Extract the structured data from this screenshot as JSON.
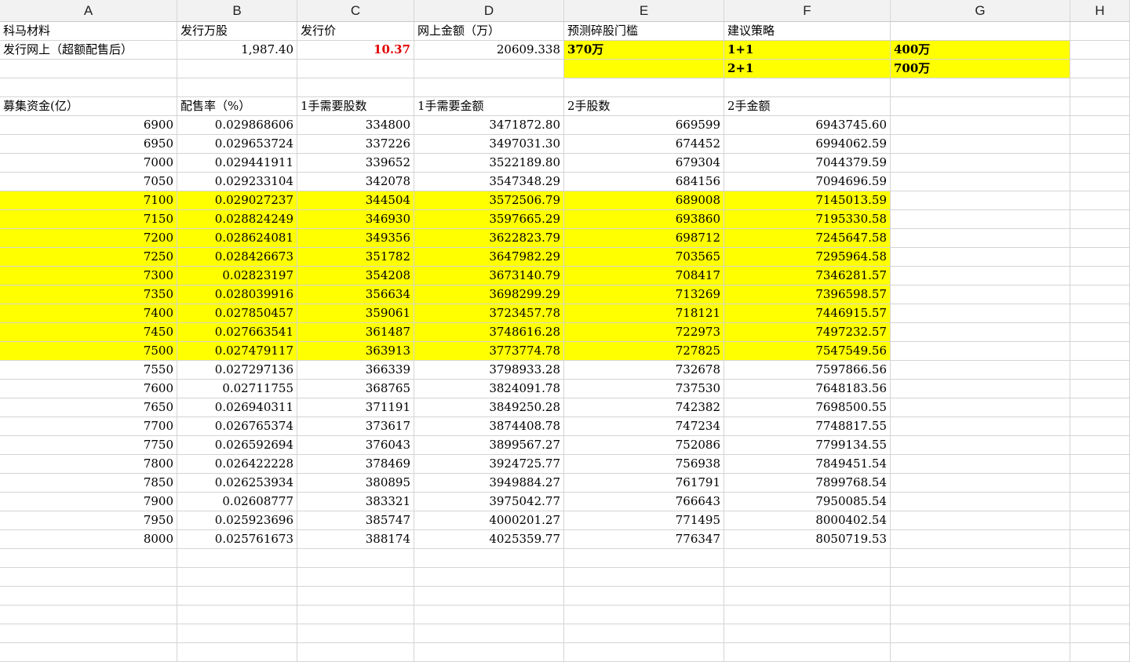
{
  "columns": [
    "A",
    "B",
    "C",
    "D",
    "E",
    "F",
    "G",
    "H"
  ],
  "info": {
    "title_label": "科马材料",
    "shares_label": "发行万股",
    "price_label": "发行价",
    "online_amount_label": "网上金额（万）",
    "threshold_label": "预测碎股门槛",
    "strategy_label": "建议策略",
    "issue_label": "发行网上（超额配售后）",
    "shares_value": "1,987.40",
    "price_value": "10.37",
    "online_amount_value": "20609.338",
    "threshold_value": "370万",
    "strategies": [
      {
        "name": "1+1",
        "amount": "400万"
      },
      {
        "name": "2+1",
        "amount": "700万"
      }
    ]
  },
  "table": {
    "headers": [
      "募集资金(亿）",
      "配售率（%）",
      "1手需要股数",
      "1手需要金额",
      "2手股数",
      "2手金额"
    ],
    "rows": [
      [
        "6900",
        "0.029868606",
        "334800",
        "3471872.80",
        "669599",
        "6943745.60"
      ],
      [
        "6950",
        "0.029653724",
        "337226",
        "3497031.30",
        "674452",
        "6994062.59"
      ],
      [
        "7000",
        "0.029441911",
        "339652",
        "3522189.80",
        "679304",
        "7044379.59"
      ],
      [
        "7050",
        "0.029233104",
        "342078",
        "3547348.29",
        "684156",
        "7094696.59"
      ],
      [
        "7100",
        "0.029027237",
        "344504",
        "3572506.79",
        "689008",
        "7145013.59"
      ],
      [
        "7150",
        "0.028824249",
        "346930",
        "3597665.29",
        "693860",
        "7195330.58"
      ],
      [
        "7200",
        "0.028624081",
        "349356",
        "3622823.79",
        "698712",
        "7245647.58"
      ],
      [
        "7250",
        "0.028426673",
        "351782",
        "3647982.29",
        "703565",
        "7295964.58"
      ],
      [
        "7300",
        "0.02823197",
        "354208",
        "3673140.79",
        "708417",
        "7346281.57"
      ],
      [
        "7350",
        "0.028039916",
        "356634",
        "3698299.29",
        "713269",
        "7396598.57"
      ],
      [
        "7400",
        "0.027850457",
        "359061",
        "3723457.78",
        "718121",
        "7446915.57"
      ],
      [
        "7450",
        "0.027663541",
        "361487",
        "3748616.28",
        "722973",
        "7497232.57"
      ],
      [
        "7500",
        "0.027479117",
        "363913",
        "3773774.78",
        "727825",
        "7547549.56"
      ],
      [
        "7550",
        "0.027297136",
        "366339",
        "3798933.28",
        "732678",
        "7597866.56"
      ],
      [
        "7600",
        "0.02711755",
        "368765",
        "3824091.78",
        "737530",
        "7648183.56"
      ],
      [
        "7650",
        "0.026940311",
        "371191",
        "3849250.28",
        "742382",
        "7698500.55"
      ],
      [
        "7700",
        "0.026765374",
        "373617",
        "3874408.78",
        "747234",
        "7748817.55"
      ],
      [
        "7750",
        "0.026592694",
        "376043",
        "3899567.27",
        "752086",
        "7799134.55"
      ],
      [
        "7800",
        "0.026422228",
        "378469",
        "3924725.77",
        "756938",
        "7849451.54"
      ],
      [
        "7850",
        "0.026253934",
        "380895",
        "3949884.27",
        "761791",
        "7899768.54"
      ],
      [
        "7900",
        "0.02608777",
        "383321",
        "3975042.77",
        "766643",
        "7950085.54"
      ],
      [
        "7950",
        "0.025923696",
        "385747",
        "4000201.27",
        "771495",
        "8000402.54"
      ],
      [
        "8000",
        "0.025761673",
        "388174",
        "4025359.77",
        "776347",
        "8050719.53"
      ]
    ],
    "highlight_first_index": 4,
    "highlight_last_index": 12
  },
  "colors": {
    "highlight": "#ffff00",
    "price": "#e00000",
    "selection": "#1e9e5a"
  }
}
